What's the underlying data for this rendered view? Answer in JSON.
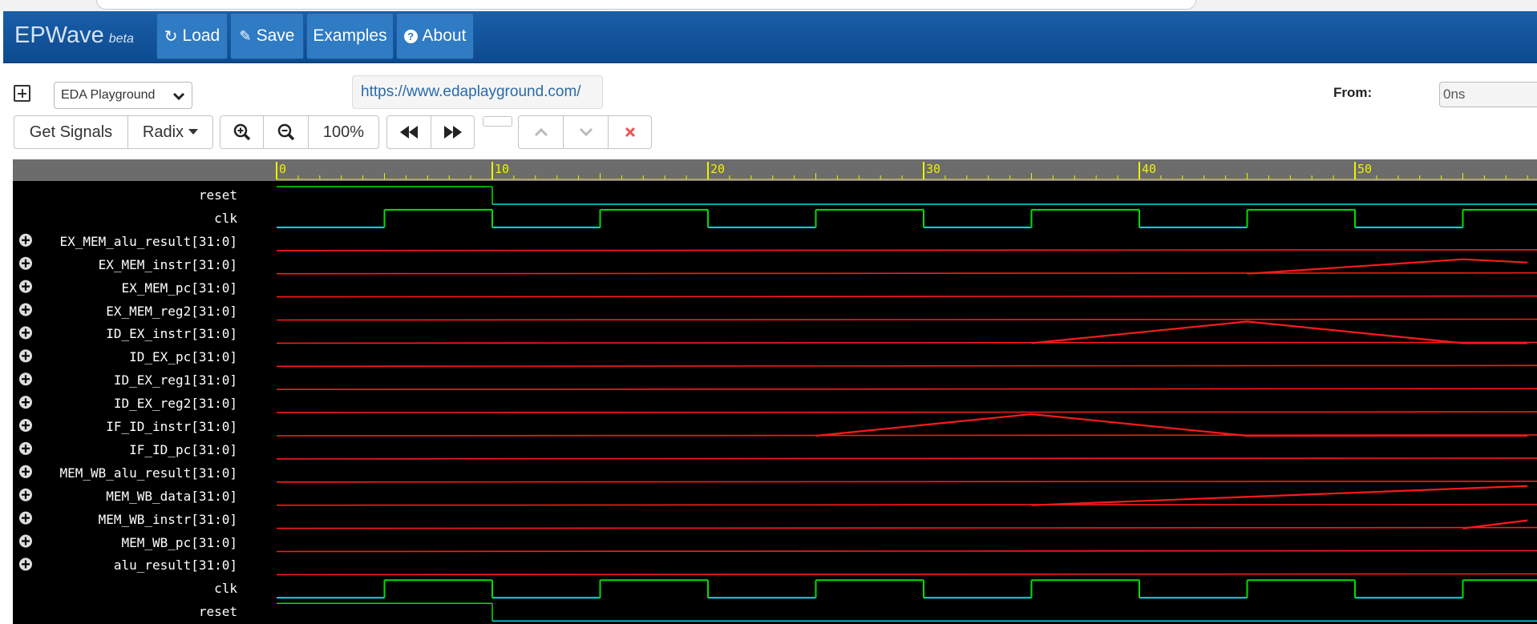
{
  "app": {
    "name": "EPWave",
    "tag": "beta"
  },
  "nav": {
    "load": "Load",
    "save": "Save",
    "examples": "Examples",
    "about": "About"
  },
  "toolbar": {
    "source_select": "EDA Playground",
    "url": "https://www.edaplayground.com/",
    "from_label": "From:",
    "from_value": "0ns",
    "get_signals": "Get Signals",
    "radix": "Radix",
    "zoom_level": "100%"
  },
  "timeline": {
    "ticks": [
      "0",
      "10",
      "20",
      "30",
      "40",
      "50"
    ]
  },
  "signals": [
    {
      "name": "reset",
      "kind": "reset",
      "expandable": false
    },
    {
      "name": "clk",
      "kind": "clk",
      "expandable": false
    },
    {
      "name": "EX_MEM_alu_result[31:0]",
      "kind": "bus",
      "expandable": true
    },
    {
      "name": "EX_MEM_instr[31:0]",
      "kind": "bus",
      "expandable": true
    },
    {
      "name": "EX_MEM_pc[31:0]",
      "kind": "bus",
      "expandable": true
    },
    {
      "name": "EX_MEM_reg2[31:0]",
      "kind": "bus",
      "expandable": true
    },
    {
      "name": "ID_EX_instr[31:0]",
      "kind": "bus",
      "expandable": true
    },
    {
      "name": "ID_EX_pc[31:0]",
      "kind": "bus",
      "expandable": true
    },
    {
      "name": "ID_EX_reg1[31:0]",
      "kind": "bus",
      "expandable": true
    },
    {
      "name": "ID_EX_reg2[31:0]",
      "kind": "bus",
      "expandable": true
    },
    {
      "name": "IF_ID_instr[31:0]",
      "kind": "bus",
      "expandable": true
    },
    {
      "name": "IF_ID_pc[31:0]",
      "kind": "bus",
      "expandable": true
    },
    {
      "name": "MEM_WB_alu_result[31:0]",
      "kind": "bus",
      "expandable": true
    },
    {
      "name": "MEM_WB_data[31:0]",
      "kind": "bus",
      "expandable": true
    },
    {
      "name": "MEM_WB_instr[31:0]",
      "kind": "bus",
      "expandable": true
    },
    {
      "name": "MEM_WB_pc[31:0]",
      "kind": "bus",
      "expandable": true
    },
    {
      "name": "alu_result[31:0]",
      "kind": "bus",
      "expandable": true
    },
    {
      "name": "clk",
      "kind": "clk",
      "expandable": false
    },
    {
      "name": "reset",
      "kind": "reset",
      "expandable": false
    }
  ],
  "colors": {
    "nav_bg": "#0d4a8f",
    "wave_bg": "#000000",
    "ruler_bg": "#6c6c6c",
    "tick_color": "#f0f000",
    "wave_high": "#00e000",
    "wave_low": "#00e0e0",
    "analog": "#ff1a1a",
    "delete": "#e85555"
  }
}
